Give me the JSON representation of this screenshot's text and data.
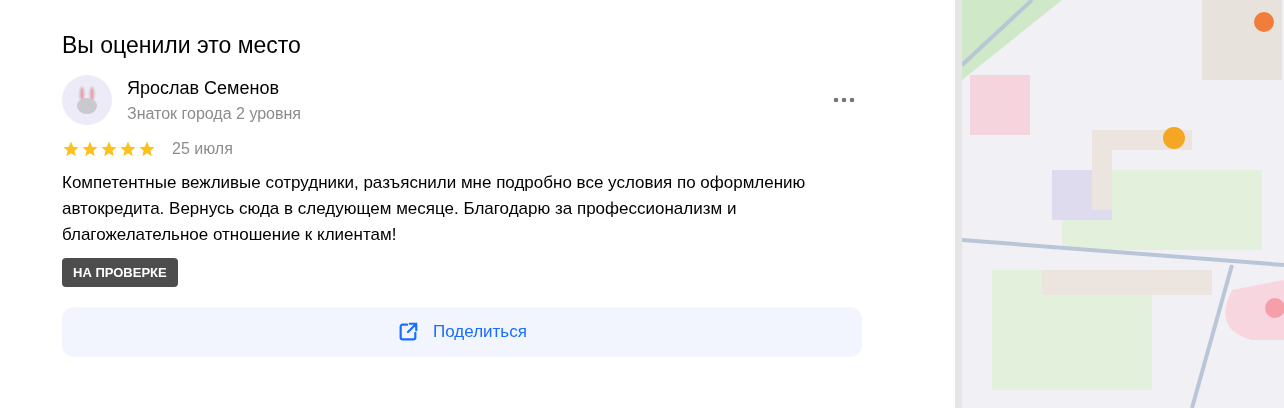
{
  "heading": "Вы оценили это место",
  "review": {
    "author": "Ярослав Семенов",
    "author_level": "Знаток города 2 уровня",
    "stars": 5,
    "date": "25 июля",
    "text": "Компетентные вежливые сотрудники, разъяснили мне подробно все условия по оформлению автокредита. Вернусь сюда в следующем месяце. Благодарю за профессионализм и благожелательное отношение к клиентам!",
    "status": "НА ПРОВЕРКЕ"
  },
  "share_button": "Поделиться"
}
